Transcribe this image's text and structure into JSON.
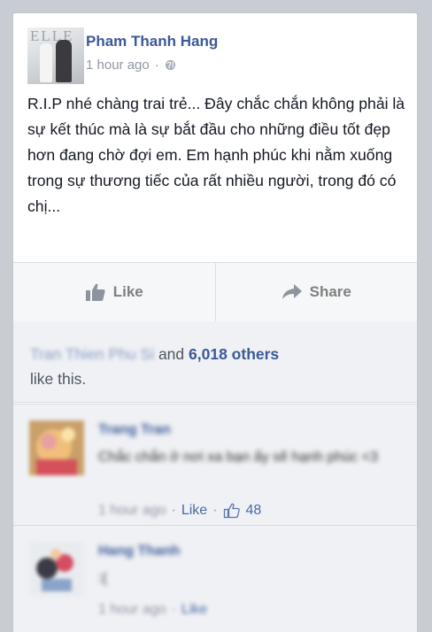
{
  "post": {
    "author": "Pham Thanh Hang",
    "time": "1 hour ago",
    "avatar_magazine": "ELLE",
    "text": "R.I.P nhé chàng trai trẻ... Đây chắc chắn không phải là sự kết thúc mà là sự bắt đầu cho những điều tốt đẹp hơn đang chờ đợi em. Em hạnh phúc khi nằm xuống trong sự thương tiếc của rất nhiều người, trong đó có chị..."
  },
  "actions": {
    "like": "Like",
    "share": "Share"
  },
  "likes": {
    "first_name": "Tran Thien Phu Si",
    "connector": "and",
    "others": "6,018 others",
    "suffix": "like this."
  },
  "comments": [
    {
      "author": "Trang Tran",
      "text": "Chắc chắn ở nơi xa bạn ấy sẽ hạnh phúc <3",
      "time": "1 hour ago",
      "like_label": "Like",
      "like_count": "48"
    },
    {
      "author": "Hang Thanh",
      "text": ":(",
      "time": "1 hour ago",
      "like_label": "Like"
    }
  ],
  "colors": {
    "link": "#3b5998",
    "meta": "#9197a3",
    "background": "#c8ccd3"
  }
}
